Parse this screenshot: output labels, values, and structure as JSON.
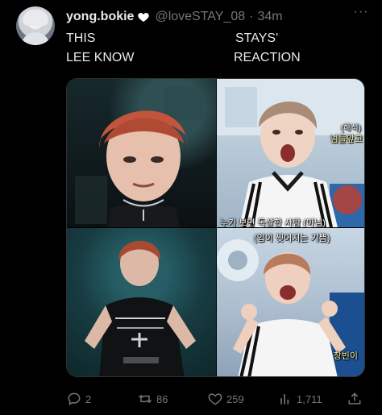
{
  "tweet": {
    "display_name": "yong.bokie",
    "handle": "@loveSTAY_08",
    "separator": "·",
    "time": "34m",
    "more_label": "···",
    "text": {
      "left_line1": "THIS",
      "left_line2": "LEE KNOW",
      "right_line1": "STAYS'",
      "right_line2": "REACTION"
    }
  },
  "media": {
    "captions": {
      "panel2_top": "(해석)",
      "panel2_top2": "넘들앞고",
      "panel2_bottom": "누가 보면 독살한 사람 (아님)",
      "panel4_top": "(입이 찢어지는 기쁨)",
      "panel4_bottom": "창빈이"
    }
  },
  "actions": {
    "reply_count": "2",
    "retweet_count": "86",
    "like_count": "259",
    "views_count": "1,711"
  },
  "icons": {
    "heart": "heart-icon",
    "more": "more-icon",
    "reply": "reply-icon",
    "retweet": "retweet-icon",
    "like": "like-icon",
    "views": "views-icon",
    "share": "share-icon"
  },
  "colors": {
    "background": "#000000",
    "text": "#e7e9ea",
    "muted": "#71767b"
  }
}
